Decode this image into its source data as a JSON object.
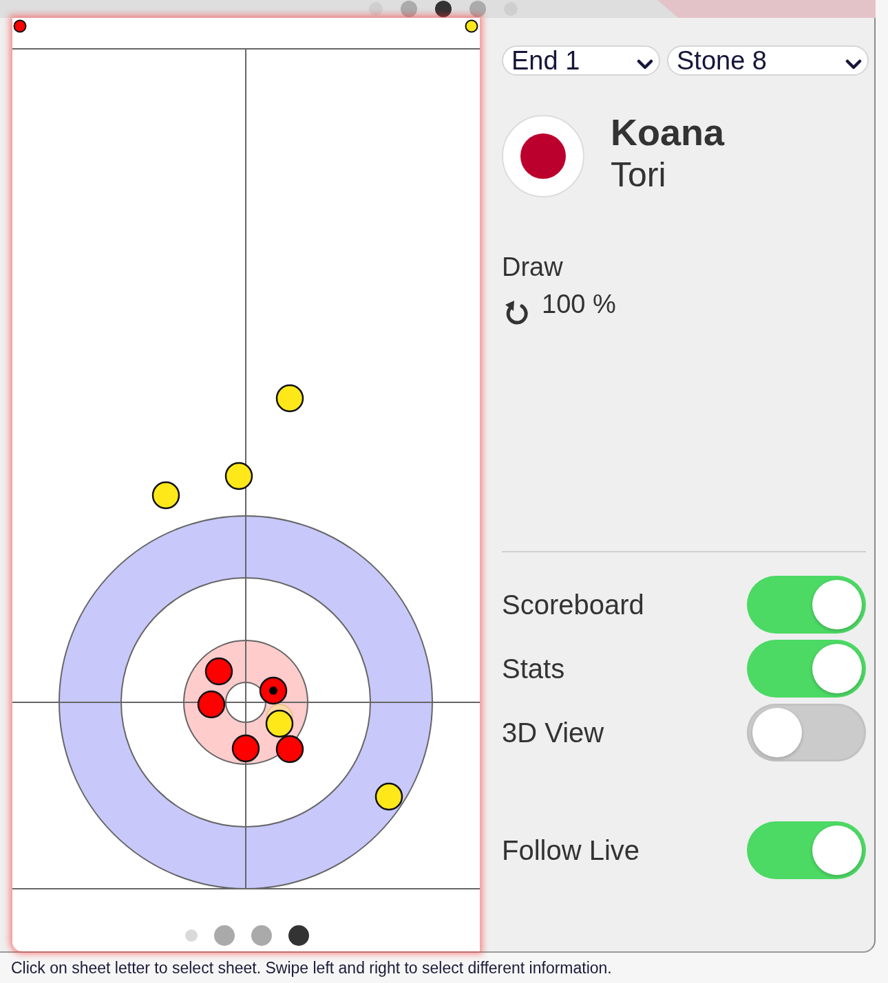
{
  "top_pager": [
    {
      "kind": "small",
      "selected": false
    },
    {
      "kind": "large",
      "selected": false
    },
    {
      "kind": "large",
      "selected": true
    },
    {
      "kind": "large",
      "selected": false
    },
    {
      "kind": "small",
      "selected": false
    }
  ],
  "sheet": {
    "team_markers": [
      {
        "color": "#ff0000"
      },
      {
        "color": "#ffe81a"
      }
    ],
    "stones": [
      {
        "color": "#ffe81a",
        "kind": "stone",
        "marked": false
      },
      {
        "color": "#ffe81a",
        "kind": "stone",
        "marked": false
      },
      {
        "color": "#ffe81a",
        "kind": "stone",
        "marked": false
      },
      {
        "color": "#ff0000",
        "kind": "stone",
        "marked": false
      },
      {
        "color": "#ff0000",
        "kind": "stone",
        "marked": true
      },
      {
        "color": "#ff0000",
        "kind": "stone",
        "marked": false
      },
      {
        "color": "#fcd9a4",
        "kind": "ghost",
        "marked": false
      },
      {
        "color": "#ffe81a",
        "kind": "stone",
        "marked": false
      },
      {
        "color": "#ff0000",
        "kind": "stone",
        "marked": false
      },
      {
        "color": "#ff0000",
        "kind": "stone",
        "marked": false
      },
      {
        "color": "#ffe81a",
        "kind": "stone",
        "marked": false
      }
    ],
    "pager": [
      {
        "kind": "small",
        "selected": false
      },
      {
        "kind": "large",
        "selected": false
      },
      {
        "kind": "large",
        "selected": false
      },
      {
        "kind": "large",
        "selected": true
      }
    ]
  },
  "selectors": [
    {
      "value": "End 1"
    },
    {
      "value": "Stone 8"
    }
  ],
  "player": {
    "team": "Koana",
    "name": "Tori"
  },
  "shot": {
    "type": "Draw",
    "clockwise": true,
    "score": "100 %"
  },
  "toggles": [
    {
      "label": "Scoreboard",
      "on": true
    },
    {
      "label": "Stats",
      "on": true
    },
    {
      "label": "3D View",
      "on": false
    }
  ],
  "follow_live": {
    "label": "Follow Live",
    "on": true
  },
  "hint": "Click on sheet letter to select sheet. Swipe left and right to select different information."
}
